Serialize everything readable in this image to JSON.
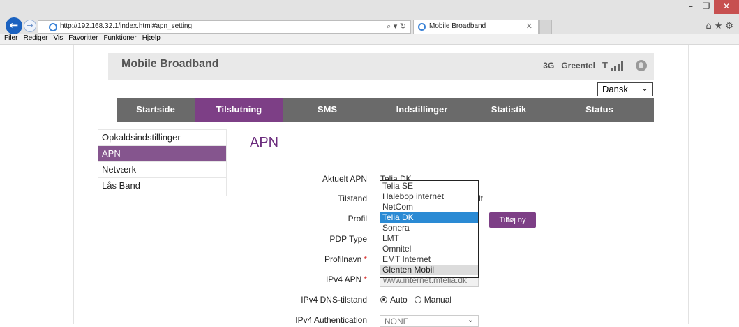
{
  "browser": {
    "url": "http://192.168.32.1/index.html#apn_setting",
    "url_host": "192.168.32.1",
    "tab_title": "Mobile Broadband",
    "search_glyph": "⌕ ▾ ↻",
    "menu": [
      "Filer",
      "Rediger",
      "Vis",
      "Favoritter",
      "Funktioner",
      "Hjælp"
    ]
  },
  "header": {
    "brand": "Mobile Broadband",
    "network_type": "3G",
    "operator": "Greentel",
    "signal_letter": "T"
  },
  "language": {
    "selected": "Dansk"
  },
  "mainnav": [
    "Startside",
    "Tilslutning",
    "SMS",
    "Indstillinger",
    "Statistik",
    "Status"
  ],
  "mainnav_active": "Tilslutning",
  "sidebar": {
    "items": [
      "Opkaldsindstillinger",
      "APN",
      "Netværk",
      "Lås Band"
    ],
    "active": "APN"
  },
  "section": {
    "title": "APN"
  },
  "form": {
    "current_apn_label": "Aktuelt APN",
    "current_apn_value": "Telia DK",
    "mode_label": "Tilstand",
    "mode_partial": "lt",
    "profile_label": "Profil",
    "add_button": "Tilføj ny",
    "pdp_label": "PDP Type",
    "profile_name_label": "Profilnavn",
    "ipv4_apn_label": "IPv4 APN",
    "ipv4_apn_value": "www.internet.mtelia.dk",
    "dns_label": "IPv4 DNS-tilstand",
    "dns_auto": "Auto",
    "dns_manual": "Manual",
    "dns_selected": "Auto",
    "auth_label": "IPv4 Authentication",
    "auth_value": "NONE",
    "required_mark": "*"
  },
  "profile_dropdown": {
    "options": [
      "Telia SE",
      "Halebop internet",
      "NetCom",
      "Telia DK",
      "Sonera",
      "LMT",
      "Omnitel",
      "EMT Internet",
      "Glenten Mobil"
    ],
    "selected": "Telia DK",
    "hovered": "Glenten Mobil"
  },
  "colors": {
    "accent_purple": "#7d3f86",
    "nav_gray": "#6a6a6a",
    "selection_blue": "#2a8ad4",
    "required_red": "#d9302d"
  }
}
